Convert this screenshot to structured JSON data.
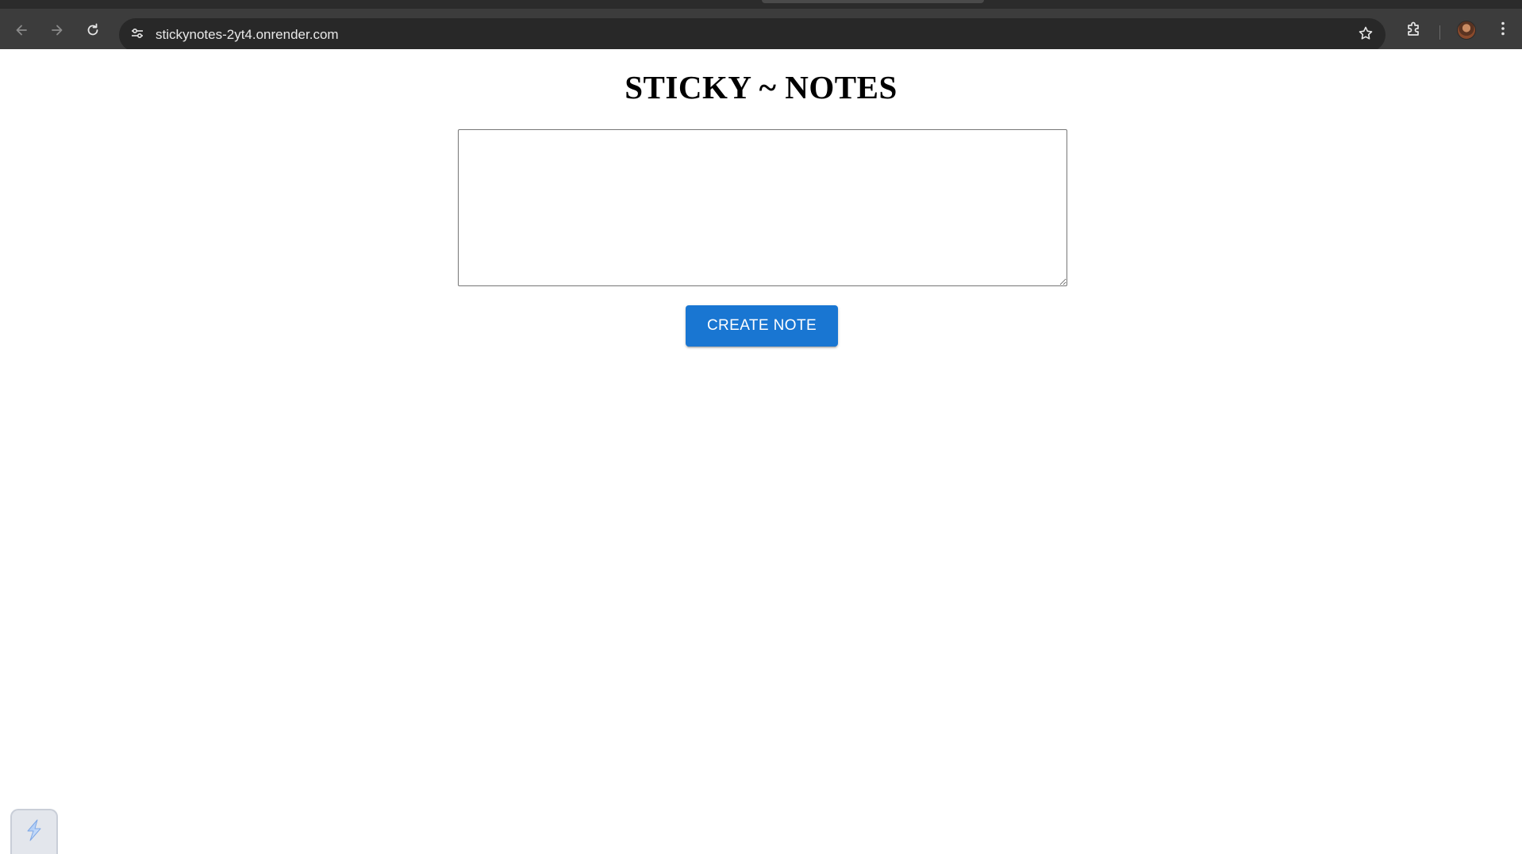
{
  "browser": {
    "url": "stickynotes-2yt4.onrender.com",
    "icons": {
      "back": "arrow-left-icon",
      "forward": "arrow-right-icon",
      "reload": "reload-icon",
      "site_info": "tune-icon",
      "bookmark": "star-icon",
      "extensions": "puzzle-icon",
      "profile": "avatar",
      "menu": "more-vertical-icon"
    },
    "colors": {
      "toolbar": "#3c3c3c",
      "omnibox": "#282828"
    }
  },
  "page": {
    "title": "STICKY ~ NOTES",
    "note_input": {
      "value": "",
      "placeholder": ""
    },
    "create_button_label": "CREATE NOTE",
    "colors": {
      "button": "#1976d2",
      "button_text": "#ffffff"
    }
  },
  "widget": {
    "icon": "lightning-icon"
  }
}
